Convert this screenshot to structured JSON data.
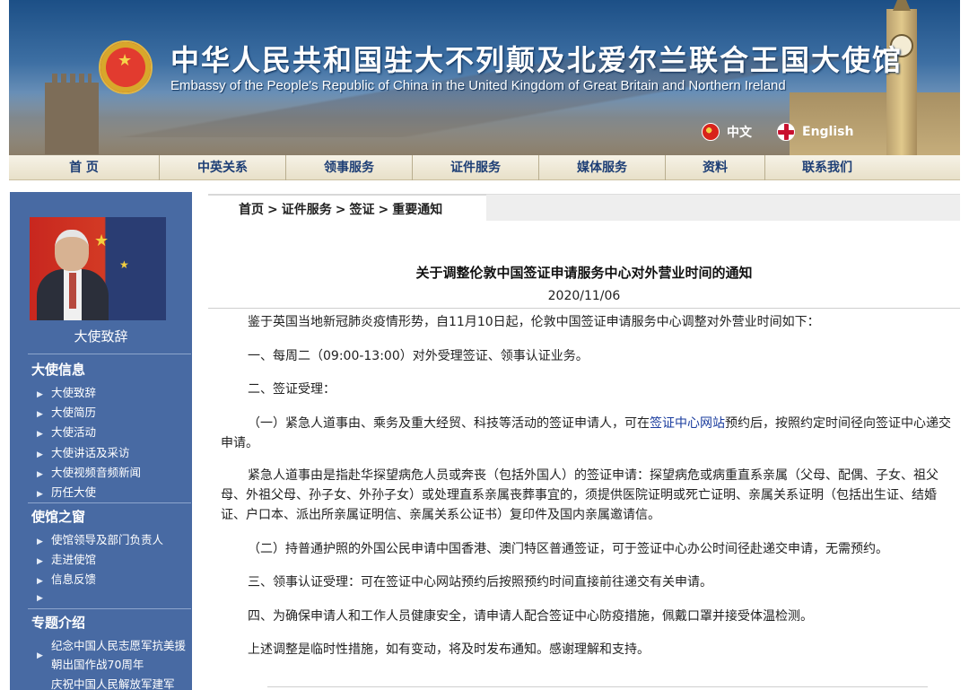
{
  "banner": {
    "title_cn": "中华人民共和国驻大不列颠及北爱尔兰联合王国大使馆",
    "title_en": "Embassy of the People's Republic of China in the United Kingdom of Great Britain and Northern Ireland",
    "lang_cn": "中文",
    "lang_en": "English"
  },
  "nav": {
    "items": [
      "首 页",
      "中英关系",
      "领事服务",
      "证件服务",
      "媒体服务",
      "资料",
      "联系我们"
    ]
  },
  "sidebar": {
    "photo_caption": "大使致辞",
    "sections": [
      {
        "title": "大使信息",
        "links": [
          "大使致辞",
          "大使简历",
          "大使活动",
          "大使讲话及采访",
          "大使视频音频新闻",
          "历任大使"
        ]
      },
      {
        "title": "使馆之窗",
        "links": [
          "使馆领导及部门负责人",
          "走进使馆",
          "信息反馈",
          ""
        ]
      },
      {
        "title": "专题介绍",
        "links": [
          "纪念中国人民志愿军抗美援朝出国作战70周年",
          "庆祝中国人民解放军建军"
        ]
      }
    ]
  },
  "breadcrumb": {
    "items": [
      "首页",
      "证件服务",
      "签证",
      "重要通知"
    ],
    "separator": ">"
  },
  "article": {
    "title": "关于调整伦敦中国签证申请服务中心对外营业时间的通知",
    "date": "2020/11/06",
    "p1": "鉴于英国当地新冠肺炎疫情形势，自11月10日起，伦敦中国签证申请服务中心调整对外营业时间如下：",
    "p2": "一、每周二（09:00-13:00）对外受理签证、领事认证业务。",
    "p3": "二、签证受理：",
    "p4_before": "（一）紧急人道事由、乘务及重大经贸、科技等活动的签证申请人，可在",
    "p4_link": "签证中心网站",
    "p4_after": "预约后，按照约定时间径向签证中心递交申请。",
    "p5": "紧急人道事由是指赴华探望病危人员或奔丧（包括外国人）的签证申请：探望病危或病重直系亲属（父母、配偶、子女、祖父母、外祖父母、孙子女、外孙子女）或处理直系亲属丧葬事宜的，须提供医院证明或死亡证明、亲属关系证明（包括出生证、结婚证、户口本、派出所亲属证明信、亲属关系公证书）复印件及国内亲属邀请信。",
    "p6": "（二）持普通护照的外国公民申请中国香港、澳门特区普通签证，可于签证中心办公时间径赴递交申请，无需预约。",
    "p7": "三、领事认证受理：可在签证中心网站预约后按照预约时间直接前往递交有关申请。",
    "p8": "四、为确保申请人和工作人员健康安全，请申请人配合签证中心防疫措施，佩戴口罩并接受体温检测。",
    "p9": "上述调整是临时性措施，如有变动，将及时发布通知。感谢理解和支持。"
  },
  "colors": {
    "sidebar_bg": "#486aa3",
    "nav_text": "#1d3e75",
    "link": "#1a3c9e"
  }
}
